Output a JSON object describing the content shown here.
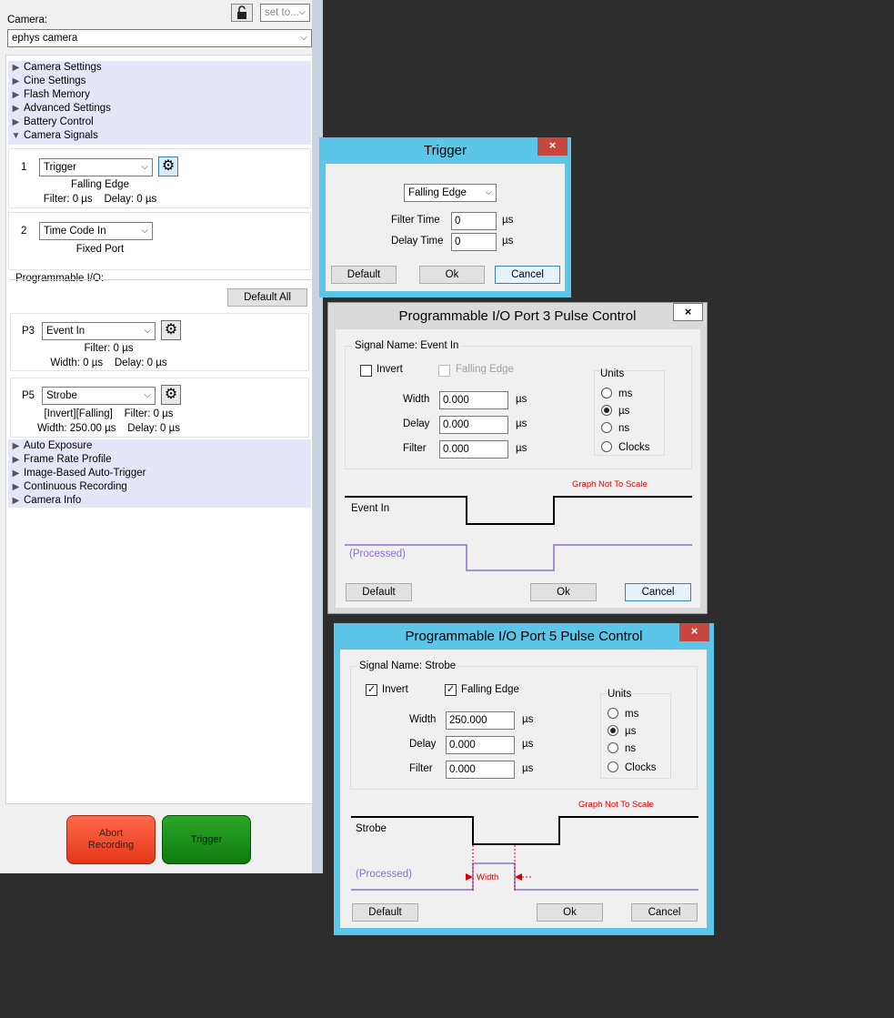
{
  "panel": {
    "camera_label": "Camera:",
    "camera_value": "ephys camera",
    "set_to_placeholder": "set to...",
    "lock_icon": "unlock-icon",
    "tree_top": [
      "Camera Settings",
      "Cine Settings",
      "Flash Memory",
      "Advanced Settings",
      "Battery Control",
      "Camera Signals"
    ],
    "signal1": {
      "num": "1",
      "select": "Trigger",
      "line1": "Falling Edge",
      "line2": "Filter: 0 µs    Delay: 0 µs"
    },
    "signal2": {
      "num": "2",
      "select": "Time Code In",
      "line1": "Fixed Port"
    },
    "prog_io_label": "Programmable I/O:",
    "default_all": "Default All",
    "p3": {
      "num": "P3",
      "select": "Event In",
      "line1": "Filter: 0 µs",
      "line2": "Width: 0 µs    Delay: 0 µs"
    },
    "p5": {
      "num": "P5",
      "select": "Strobe",
      "line1": "[Invert][Falling]    Filter: 0 µs",
      "line2": "Width: 250.00 µs    Delay: 0 µs"
    },
    "tree_bottom": [
      "Auto Exposure",
      "Frame Rate Profile",
      "Image-Based Auto-Trigger",
      "Continuous Recording",
      "Camera Info"
    ],
    "abort_label": "Abort\nRecording",
    "trigger_label": "Trigger",
    "abort_color": "#e5361a",
    "trigger_color": "#0e7a0e"
  },
  "trigger_dialog": {
    "title": "Trigger",
    "close": "×",
    "edge_select": "Falling Edge",
    "filter_label": "Filter Time",
    "filter_value": "0",
    "delay_label": "Delay Time",
    "delay_value": "0",
    "unit": "µs",
    "default": "Default",
    "ok": "Ok",
    "cancel": "Cancel",
    "accent": "#5bc6e8"
  },
  "port3_dialog": {
    "title": "Programmable I/O Port 3 Pulse Control",
    "close": "×",
    "signal_name": "Signal Name: Event In",
    "invert_label": "Invert",
    "invert_checked": false,
    "falling_label": "Falling Edge",
    "falling_checked": false,
    "width_label": "Width",
    "width_value": "0.000",
    "delay_label": "Delay",
    "delay_value": "0.000",
    "filter_label": "Filter",
    "filter_value": "0.000",
    "unit": "µs",
    "units_title": "Units",
    "units": [
      "ms",
      "µs",
      "ns",
      "Clocks"
    ],
    "units_selected": "µs",
    "graph_note": "Graph Not To Scale",
    "signal_trace": "Event In",
    "processed_trace": "(Processed)",
    "default": "Default",
    "ok": "Ok",
    "cancel": "Cancel"
  },
  "port5_dialog": {
    "title": "Programmable I/O Port 5 Pulse Control",
    "close": "×",
    "signal_name": "Signal Name: Strobe",
    "invert_label": "Invert",
    "invert_checked": true,
    "falling_label": "Falling Edge",
    "falling_checked": true,
    "width_label": "Width",
    "width_value": "250.000",
    "delay_label": "Delay",
    "delay_value": "0.000",
    "filter_label": "Filter",
    "filter_value": "0.000",
    "unit": "µs",
    "units_title": "Units",
    "units": [
      "ms",
      "µs",
      "ns",
      "Clocks"
    ],
    "units_selected": "µs",
    "graph_note": "Graph Not To Scale",
    "signal_trace": "Strobe",
    "processed_trace": "(Processed)",
    "width_marker": "Width",
    "default": "Default",
    "ok": "Ok",
    "cancel": "Cancel"
  }
}
